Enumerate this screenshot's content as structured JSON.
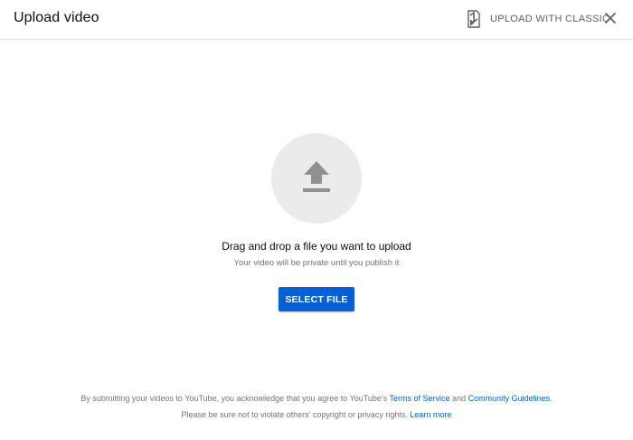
{
  "dialog": {
    "title": "Upload video",
    "classic_label": "UPLOAD WITH CLASSIC",
    "classic_icon": "classic-studio-icon",
    "close_icon": "close-icon"
  },
  "upload": {
    "icon": "upload-arrow-icon",
    "drag_text": "Drag and drop a file you want to upload",
    "private_text": "Your video will be private until you publish it",
    "select_button": "SELECT FILE"
  },
  "footer": {
    "line1_prefix": "By submitting your videos to YouTube, you acknowledge that you agree to YouTube's",
    "terms_link": "Terms of Service",
    "and_text": "and",
    "guidelines_link": "Community Guidelines",
    "line1_suffix": ".",
    "line2_text": "Please be sure not to violate others' copyright or privacy rights.",
    "learn_more_link": "Learn more"
  },
  "colors": {
    "accent": "#065fd4",
    "icon_gray": "#909090",
    "circle_bg": "#ebebeb",
    "secondary_text": "#737373"
  }
}
